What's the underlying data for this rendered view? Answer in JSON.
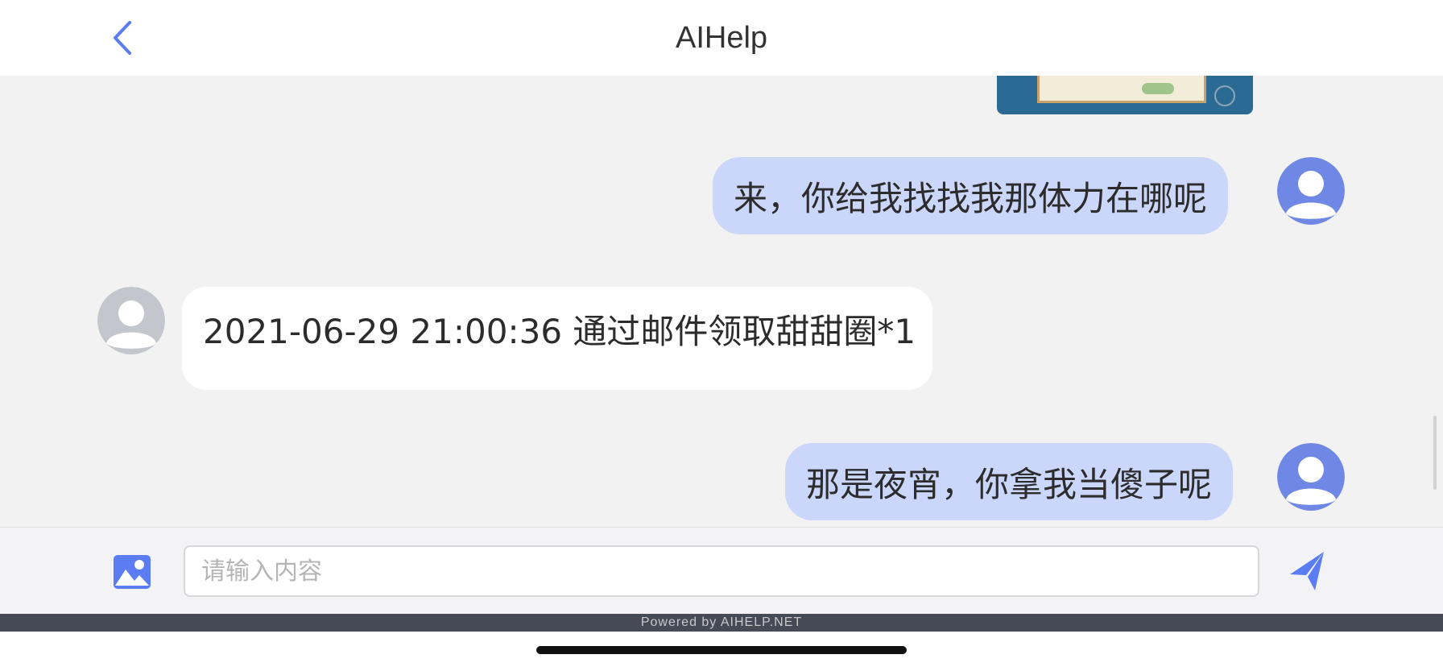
{
  "header": {
    "title": "AIHelp",
    "back_icon": "chevron-left-icon",
    "accent_color": "#5b7cf2"
  },
  "messages": [
    {
      "sender": "user",
      "type": "image",
      "content": "screenshot-thumbnail"
    },
    {
      "sender": "user",
      "type": "text",
      "text": "来，你给我找找我那体力在哪呢"
    },
    {
      "sender": "agent",
      "type": "text",
      "text": "2021-06-29 21:00:36 通过邮件领取甜甜圈*1"
    },
    {
      "sender": "user",
      "type": "text",
      "text": "那是夜宵，你拿我当傻子呢"
    }
  ],
  "composer": {
    "image_icon": "image-icon",
    "placeholder": "请输入内容",
    "value": "",
    "send_icon": "send-icon"
  },
  "footer": {
    "powered_by": "Powered by AIHELP.NET"
  },
  "colors": {
    "user_bubble": "#cbd6fb",
    "agent_bubble": "#ffffff",
    "user_avatar": "#7088e5",
    "agent_avatar": "#c3c6cd",
    "background": "#f2f2f2"
  }
}
